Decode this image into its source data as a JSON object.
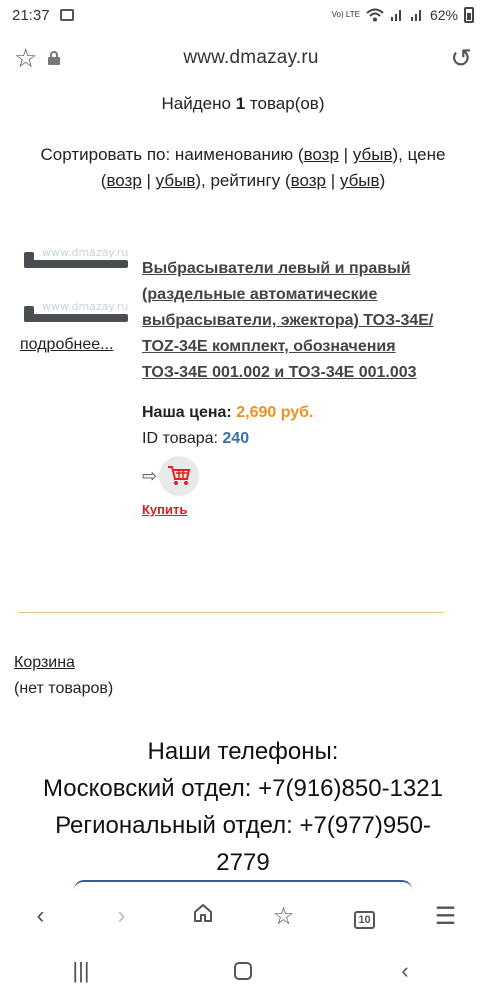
{
  "status": {
    "time": "21:37",
    "battery": "62%",
    "network": "Vo) LTE"
  },
  "browser": {
    "url": "www.dmazay.ru"
  },
  "found": {
    "prefix": "Найдено",
    "count": "1",
    "suffix": "товар(ов)"
  },
  "sort": {
    "label": "Сортировать по: наименованию",
    "name_asc": "возр",
    "name_desc": "убыв",
    "price_label": "цене",
    "price_asc": "возр",
    "price_desc": "убыв",
    "rating_label": "рейтингу",
    "rating_asc": "возр",
    "rating_desc": "убыв"
  },
  "product": {
    "watermark": "www.dmazay.ru",
    "more_link": "подробнее...",
    "title": "Выбрасыватели левый и правый (раздельные автоматические выбрасыватели, эжектора) ТОЗ-34Е/ TOZ-34E комплект, обозначения ТОЗ-34Е 001.002 и ТОЗ-34Е 001.003",
    "price_label": "Наша цена:",
    "price": "2,690 руб.",
    "id_label": "ID товара:",
    "id": "240",
    "buy_label": "Купить"
  },
  "cart": {
    "title": "Корзина",
    "status": "(нет товаров)"
  },
  "phones": {
    "heading": "Наши телефоны:",
    "moscow": "Московский отдел: +7(916)850-1321",
    "regional_line1": "Региональный отдел: +7(977)950-",
    "regional_line2": "2779"
  },
  "nav": {
    "tabs_count": "10"
  },
  "colors": {
    "price": "#f0901e",
    "id": "#3b6ea8",
    "buy": "#d62020",
    "divider": "#e8c98c"
  },
  "icons": [
    "gallery-icon",
    "wifi-icon",
    "signal-icon",
    "battery-icon",
    "star-icon",
    "lock-icon",
    "reload-icon",
    "cart-icon",
    "back-icon",
    "forward-icon",
    "home-icon",
    "bookmark-icon",
    "tabs-icon",
    "menu-icon",
    "recents-icon",
    "sys-home-icon",
    "sys-back-icon"
  ]
}
